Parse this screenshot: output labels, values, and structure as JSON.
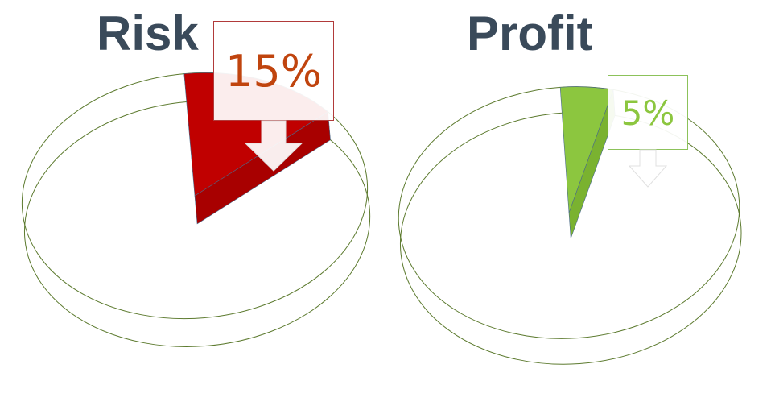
{
  "chart_data": [
    {
      "type": "pie",
      "title": "Risk",
      "values": [
        15,
        85
      ],
      "data_label": "15%",
      "colors": {
        "slice": "#c00000",
        "slice_side": "#a80000",
        "label": "#c0440e",
        "outline": "#5c7a2e",
        "callout_border": "#b13a3a"
      }
    },
    {
      "type": "pie",
      "title": "Profit",
      "values": [
        5,
        95
      ],
      "data_label": "5%",
      "colors": {
        "slice": "#8cc63f",
        "slice_side": "#7ab230",
        "label": "#8cc63f",
        "outline": "#5c7a2e",
        "callout_border": "#8cc25a"
      }
    }
  ]
}
